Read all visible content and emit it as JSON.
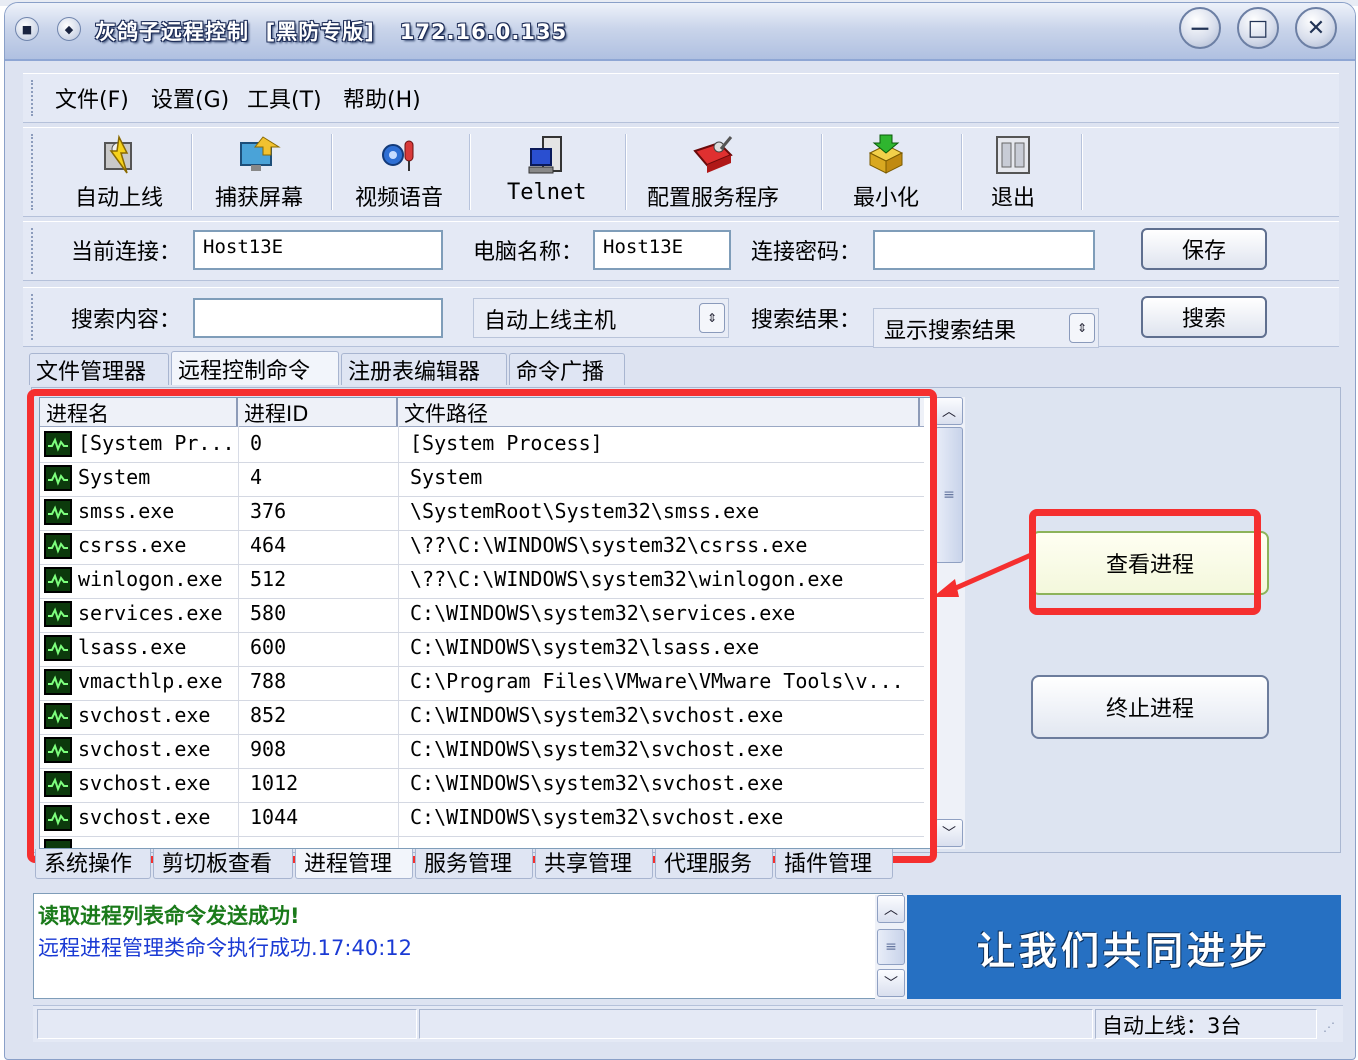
{
  "window": {
    "title": "灰鸽子远程控制  [黑防专版]   172.16.0.135",
    "minimize_label": "－",
    "maximize_label": "□",
    "close_label": "✕"
  },
  "menu": [
    "文件(F)",
    "设置(G)",
    "工具(T)",
    "帮助(H)"
  ],
  "toolbar": [
    {
      "label": "自动上线",
      "icon": "auto-online-icon"
    },
    {
      "label": "捕获屏幕",
      "icon": "capture-screen-icon"
    },
    {
      "label": "视频语音",
      "icon": "video-voice-icon"
    },
    {
      "label": "Telnet",
      "icon": "telnet-icon"
    },
    {
      "label": "配置服务程序",
      "icon": "configure-server-icon"
    },
    {
      "label": "最小化",
      "icon": "minimize-icon"
    },
    {
      "label": "退出",
      "icon": "exit-icon"
    }
  ],
  "connection": {
    "current_label": "当前连接：",
    "current_value": "Host13E",
    "computer_label": "电脑名称：",
    "computer_value": "Host13E",
    "password_label": "连接密码：",
    "password_value": "",
    "save_label": "保存"
  },
  "search": {
    "content_label": "搜索内容：",
    "content_value": "",
    "scope_value": "自动上线主机",
    "result_label": "搜索结果：",
    "result_value": "显示搜索结果",
    "search_label": "搜索"
  },
  "tabs": [
    "文件管理器",
    "远程控制命令",
    "注册表编辑器",
    "命令广播"
  ],
  "active_tab": 1,
  "process_list": {
    "columns": [
      "进程名",
      "进程ID",
      "文件路径"
    ],
    "rows": [
      {
        "name": "[System Pr...",
        "pid": "0",
        "path": "[System Process]"
      },
      {
        "name": "System",
        "pid": "4",
        "path": "System"
      },
      {
        "name": "smss.exe",
        "pid": "376",
        "path": "\\SystemRoot\\System32\\smss.exe"
      },
      {
        "name": "csrss.exe",
        "pid": "464",
        "path": "\\??\\C:\\WINDOWS\\system32\\csrss.exe"
      },
      {
        "name": "winlogon.exe",
        "pid": "512",
        "path": "\\??\\C:\\WINDOWS\\system32\\winlogon.exe"
      },
      {
        "name": "services.exe",
        "pid": "580",
        "path": "C:\\WINDOWS\\system32\\services.exe"
      },
      {
        "name": "lsass.exe",
        "pid": "600",
        "path": "C:\\WINDOWS\\system32\\lsass.exe"
      },
      {
        "name": "vmacthlp.exe",
        "pid": "788",
        "path": "C:\\Program Files\\VMware\\VMware Tools\\v..."
      },
      {
        "name": "svchost.exe",
        "pid": "852",
        "path": "C:\\WINDOWS\\system32\\svchost.exe"
      },
      {
        "name": "svchost.exe",
        "pid": "908",
        "path": "C:\\WINDOWS\\system32\\svchost.exe"
      },
      {
        "name": "svchost.exe",
        "pid": "1012",
        "path": "C:\\WINDOWS\\system32\\svchost.exe"
      },
      {
        "name": "svchost.exe",
        "pid": "1044",
        "path": "C:\\WINDOWS\\system32\\svchost.exe"
      }
    ]
  },
  "actions": {
    "view_label": "查看进程",
    "kill_label": "终止进程"
  },
  "sub_tabs": [
    "系统操作",
    "剪切板查看",
    "进程管理",
    "服务管理",
    "共享管理",
    "代理服务",
    "插件管理"
  ],
  "active_sub_tab": 2,
  "log": {
    "line1": "读取进程列表命令发送成功!",
    "line2": "远程进程管理类命令执行成功.17:40:12"
  },
  "banner": "让我们共同进步",
  "status": {
    "online_count": "自动上线：3台"
  },
  "colors": {
    "highlight": "#f52f2f",
    "banner_bg": "#2670c2",
    "log_success": "#1a7a1a",
    "log_info": "#1a3ad4",
    "button_highlight_border": "#8cb35a"
  }
}
